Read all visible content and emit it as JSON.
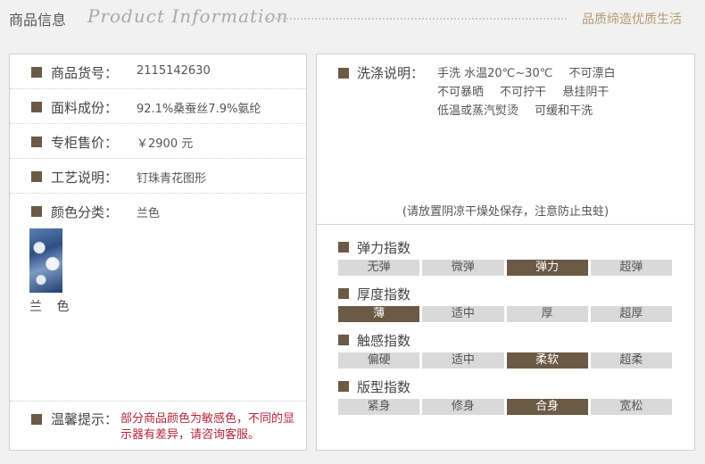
{
  "header": {
    "title_cn": "商品信息",
    "title_en": "Product Information",
    "slogan": "品质缔造优质生活"
  },
  "info": {
    "rows": [
      {
        "label": "商品货号：",
        "value": "2115142630"
      },
      {
        "label": "面料成份：",
        "value": "92.1%桑蚕丝7.9%氨纶"
      },
      {
        "label": "专柜售价：",
        "value": "￥2900 元"
      },
      {
        "label": "工艺说明：",
        "value": "钉珠青花图形"
      },
      {
        "label": "颜色分类：",
        "value": "兰色"
      }
    ],
    "swatch_label": "兰 色",
    "tip_label": "温馨提示：",
    "tip_text": "部分商品颜色为敏感色，不同的显示器有差异，请咨询客服。"
  },
  "care": {
    "label": "洗涤说明：",
    "line1a": "手洗 水温20℃~30℃",
    "line1b": "不可漂白",
    "line2a": "不可暴晒",
    "line2b": "不可拧干",
    "line2c": "悬挂阴干",
    "line3a": "低温或蒸汽熨烫",
    "line3b": "可缓和干洗",
    "note": "(请放置阴凉干燥处保存，注意防止虫蛀)"
  },
  "indices": [
    {
      "label": "弹力指数",
      "options": [
        "无弹",
        "微弹",
        "弹力",
        "超弹"
      ],
      "selected": 2
    },
    {
      "label": "厚度指数",
      "options": [
        "薄",
        "适中",
        "厚",
        "超厚"
      ],
      "selected": 0
    },
    {
      "label": "触感指数",
      "options": [
        "偏硬",
        "适中",
        "柔软",
        "超柔"
      ],
      "selected": 2
    },
    {
      "label": "版型指数",
      "options": [
        "紧身",
        "修身",
        "合身",
        "宽松"
      ],
      "selected": 2
    }
  ],
  "colors": {
    "accent": "#6b5a45",
    "tip": "#b4253b",
    "slogan": "#b49a72"
  }
}
